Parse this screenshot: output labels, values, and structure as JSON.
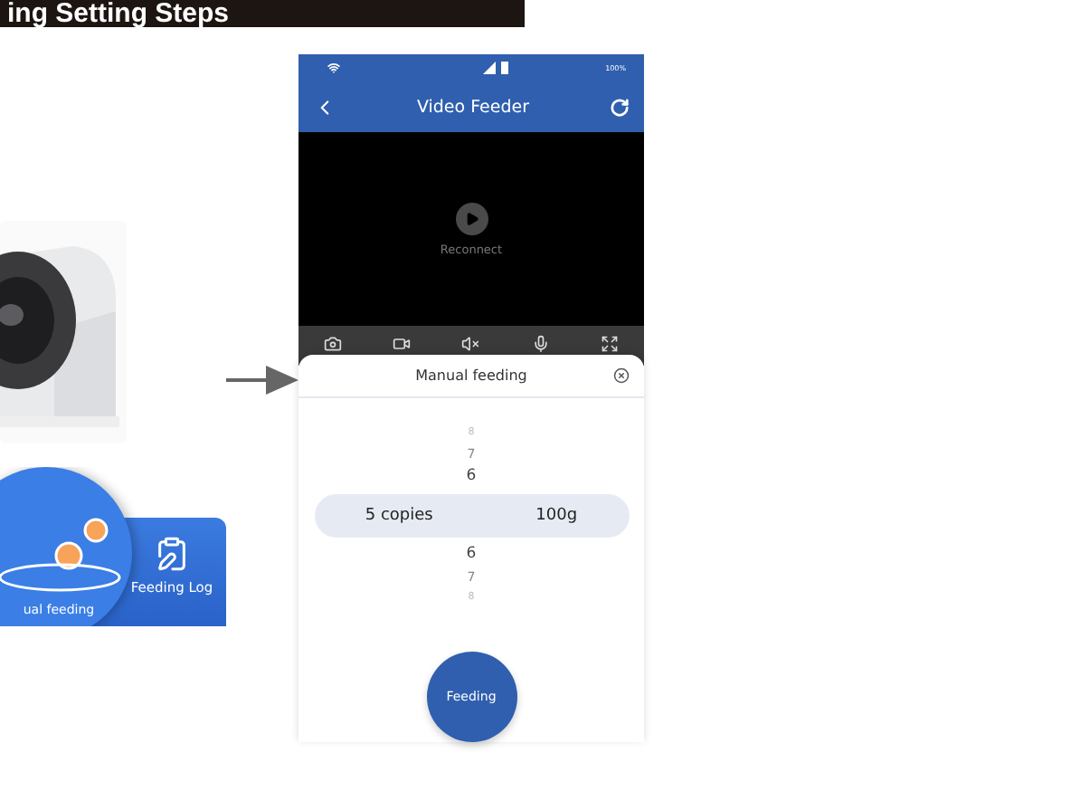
{
  "banner": {
    "title": "ing Setting Steps"
  },
  "app_panel": {
    "items": [
      {
        "kind": "feed",
        "label": "ual feeding",
        "selected": true
      },
      {
        "kind": "log",
        "label": "Feeding Log",
        "selected": false
      }
    ]
  },
  "phone": {
    "status": {
      "battery": "100%"
    },
    "header": {
      "title": "Video Feeder"
    },
    "video": {
      "status": "Reconnect"
    },
    "sheet": {
      "title": "Manual feeding",
      "picker_above": [
        "8",
        "7",
        "6"
      ],
      "selected": {
        "copies": "5 copies",
        "weight": "100g"
      },
      "picker_below": [
        "6",
        "7",
        "8"
      ],
      "button": "Feeding"
    }
  }
}
